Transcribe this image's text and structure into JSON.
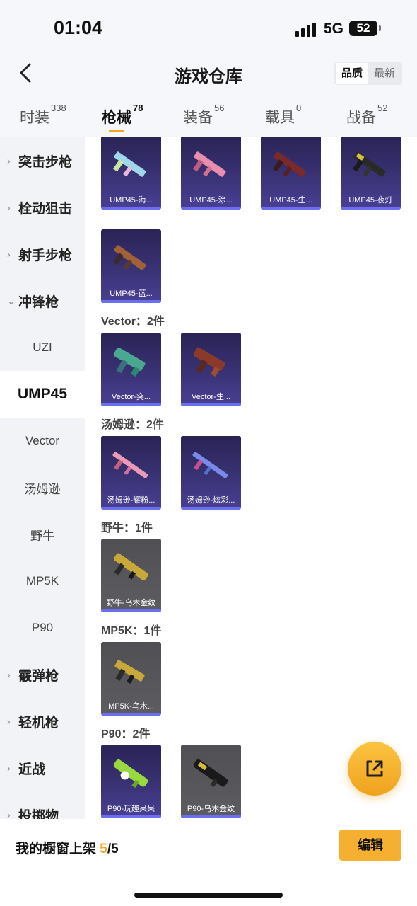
{
  "status": {
    "time": "01:04",
    "network": "5G",
    "battery": "52"
  },
  "header": {
    "title": "游戏仓库",
    "sort_options": [
      "品质",
      "最新"
    ],
    "active_sort": "品质"
  },
  "tabs": [
    {
      "label": "时装",
      "count": "338"
    },
    {
      "label": "枪械",
      "count": "78"
    },
    {
      "label": "装备",
      "count": "56"
    },
    {
      "label": "载具",
      "count": "0"
    },
    {
      "label": "战备",
      "count": "52"
    }
  ],
  "active_tab": "枪械",
  "sidebar": {
    "items": [
      {
        "label": "突击步枪",
        "chev": "›"
      },
      {
        "label": "栓动狙击",
        "chev": "›"
      },
      {
        "label": "射手步枪",
        "chev": "›"
      },
      {
        "label": "冲锋枪",
        "chev": "⌄"
      },
      {
        "label": "UZI"
      },
      {
        "label": "UMP45"
      },
      {
        "label": "Vector"
      },
      {
        "label": "汤姆逊"
      },
      {
        "label": "野牛"
      },
      {
        "label": "MP5K"
      },
      {
        "label": "P90"
      },
      {
        "label": "霰弹枪",
        "chev": "›"
      },
      {
        "label": "轻机枪",
        "chev": "›"
      },
      {
        "label": "近战",
        "chev": "›"
      },
      {
        "label": "投掷物",
        "chev": "›"
      }
    ],
    "selected": "UMP45"
  },
  "sections": [
    {
      "title": "",
      "items": [
        "UMP45-海...",
        "UMP45-涂...",
        "UMP45-生...",
        "UMP45-夜灯",
        "UMP45-蓝..."
      ]
    },
    {
      "title": "Vector：2件",
      "items": [
        "Vector-突...",
        "Vector-生..."
      ]
    },
    {
      "title": "汤姆逊：2件",
      "items": [
        "汤姆逊-耀粉...",
        "汤姆逊-炫彩..."
      ]
    },
    {
      "title": "野牛：1件",
      "items": [
        "野牛-乌木金纹"
      ]
    },
    {
      "title": "MP5K：1件",
      "items": [
        "MP5K-乌木..."
      ]
    },
    {
      "title": "P90：2件",
      "items": [
        "P90-玩趣呆呆",
        "P90-乌木金纹"
      ]
    }
  ],
  "bottom": {
    "label": "我的橱窗上架",
    "count": "5",
    "total": "/5",
    "edit": "编辑"
  },
  "colors": {
    "accent": "#f5a623",
    "rarity_purple": "#6a6ff0"
  },
  "icons": [
    "back-arrow-icon",
    "share-export-icon",
    "chevron-right-icon",
    "chevron-down-icon"
  ]
}
